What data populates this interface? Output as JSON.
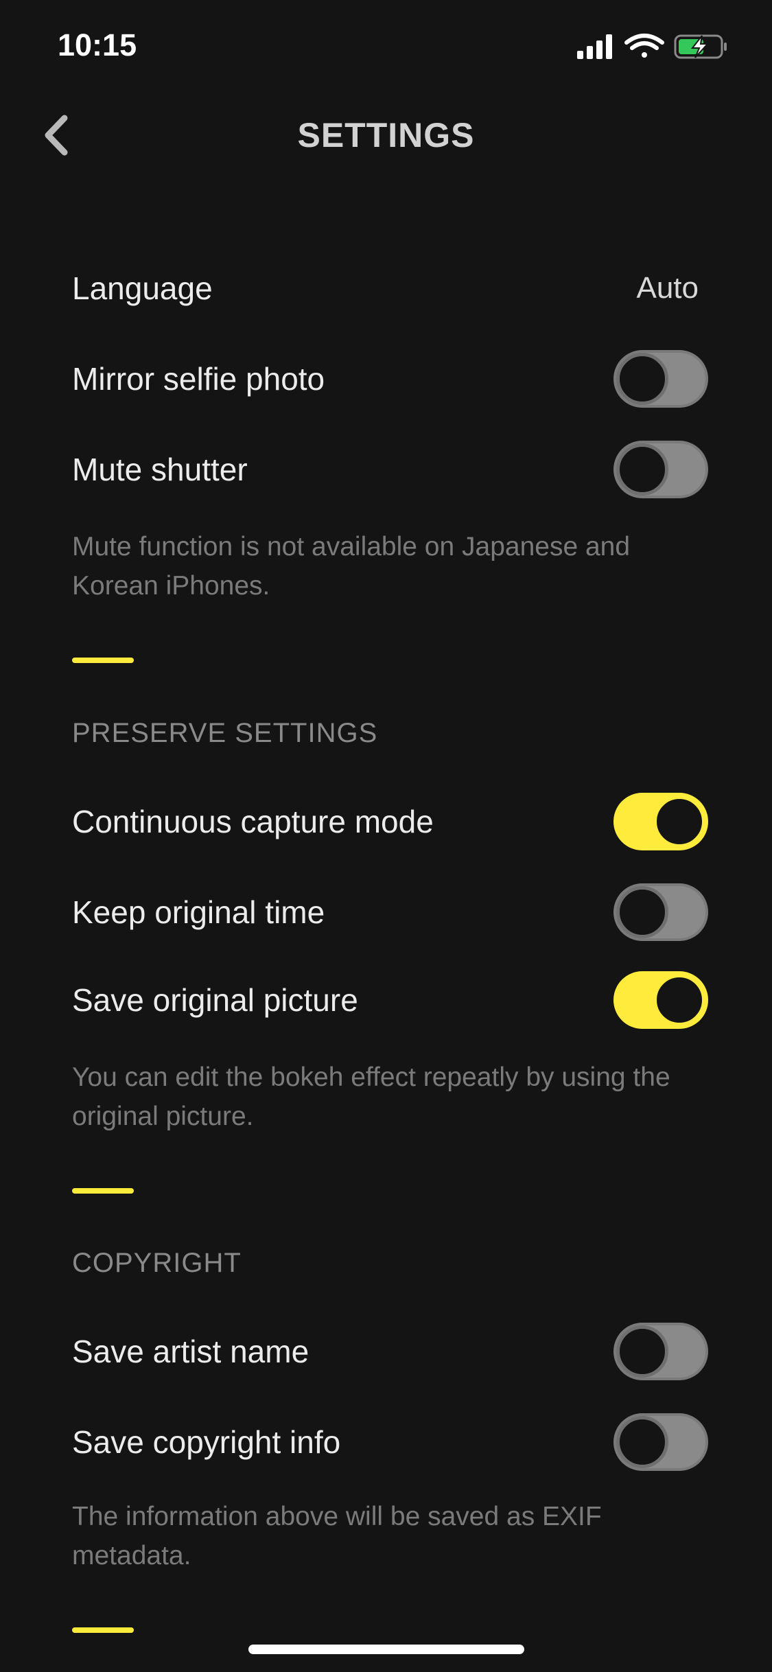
{
  "status_bar": {
    "time": "10:15"
  },
  "nav": {
    "title": "SETTINGS"
  },
  "general": {
    "language": {
      "label": "Language",
      "value": "Auto"
    },
    "mirror_selfie": {
      "label": "Mirror selfie photo",
      "on": false
    },
    "mute_shutter": {
      "label": "Mute shutter",
      "on": false
    },
    "note": "Mute function is not available on Japanese and Korean iPhones."
  },
  "preserve": {
    "header": "PRESERVE SETTINGS",
    "continuous_capture": {
      "label": "Continuous capture mode",
      "on": true
    },
    "keep_original_time": {
      "label": "Keep original time",
      "on": false
    },
    "save_original_picture": {
      "label": "Save original picture",
      "on": true
    },
    "note": "You can edit the bokeh effect repeatly by using the original picture."
  },
  "copyright": {
    "header": "COPYRIGHT",
    "save_artist_name": {
      "label": "Save artist name",
      "on": false
    },
    "save_copyright_info": {
      "label": "Save copyright info",
      "on": false
    },
    "note": "The information above will be saved as EXIF metadata."
  },
  "colors": {
    "accent": "#ffeb3b",
    "background": "#141414",
    "toggle_off": "#8a8a8a"
  }
}
